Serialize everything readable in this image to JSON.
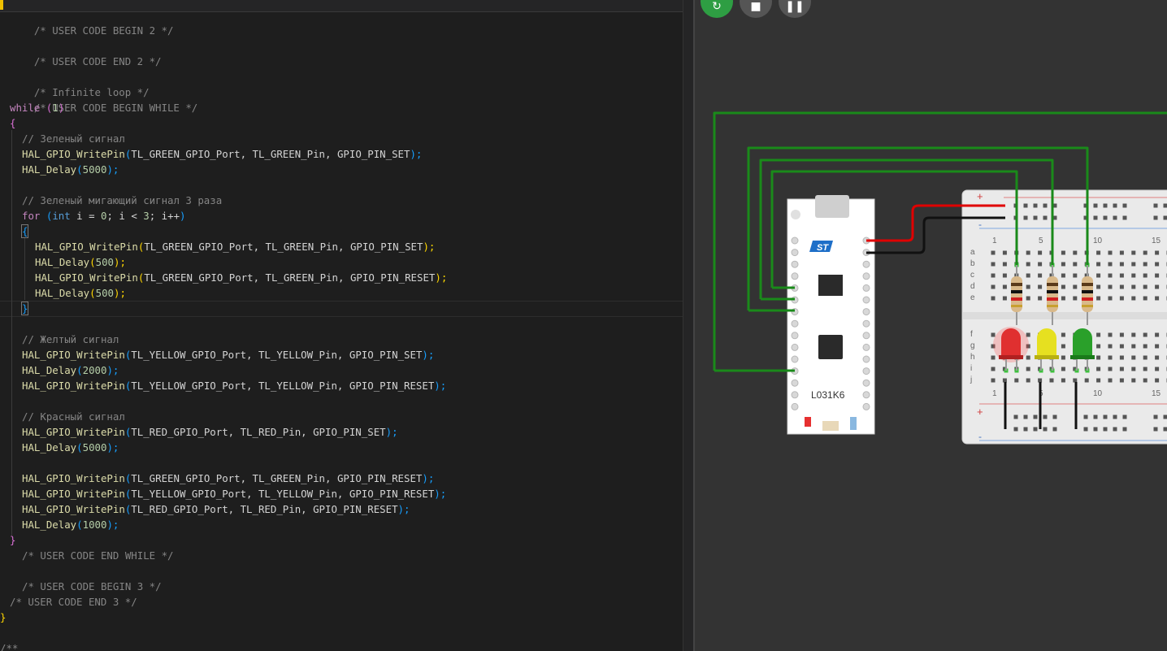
{
  "editor": {
    "comments": {
      "user_begin_2": "/* USER CODE BEGIN 2 */",
      "user_end_2": "/* USER CODE END 2 */",
      "infinite_loop": "/* Infinite loop */",
      "user_begin_while": "/* USER CODE BEGIN WHILE */",
      "green_signal": "// Зеленый сигнал",
      "green_blink": "// Зеленый мигающий сигнал 3 раза",
      "yellow_signal": "// Желтый сигнал",
      "red_signal": "// Красный сигнал",
      "user_end_while": "/* USER CODE END WHILE */",
      "user_begin_3": "/* USER CODE BEGIN 3 */",
      "user_end_3": "/* USER CODE END 3 */",
      "doc_start": "/**"
    },
    "kw": {
      "while": "while",
      "for": "for",
      "int": "int"
    },
    "fn": {
      "write_pin": "HAL_GPIO_WritePin",
      "delay": "HAL_Delay"
    },
    "args": {
      "green": "TL_GREEN_GPIO_Port, TL_GREEN_Pin, ",
      "yellow": "TL_YELLOW_GPIO_Port, TL_YELLOW_Pin, ",
      "red": "TL_RED_GPIO_Port, TL_RED_Pin, ",
      "set": "GPIO_PIN_SET",
      "reset": "GPIO_PIN_RESET"
    },
    "loop": {
      "var": " i = ",
      "cond": "; i < ",
      "inc": "; i++"
    },
    "num": {
      "one": "1",
      "zero": "0",
      "three": "3",
      "d5000": "5000",
      "d500": "500",
      "d2000": "2000",
      "d1000": "1000"
    },
    "punct": {
      "open_paren": "(",
      "close_paren": ")",
      "close_semi": ");",
      "open_brace": "{",
      "close_brace": "}",
      "space": " "
    }
  },
  "simulator": {
    "controls": {
      "restart_icon": "↻",
      "stop_icon": "■",
      "pause_icon": "❚❚"
    },
    "board": {
      "name": "L031K6",
      "logo": "ST"
    },
    "breadboard": {
      "plus": "+",
      "minus": "-",
      "row_labels_top": [
        "a",
        "b",
        "c",
        "d",
        "e"
      ],
      "row_labels_bottom": [
        "f",
        "g",
        "h",
        "i",
        "j"
      ],
      "column_numbers": [
        "1",
        "5",
        "10",
        "15"
      ]
    },
    "leds": [
      {
        "color": "red",
        "hex": "#e03030"
      },
      {
        "color": "yellow",
        "hex": "#e6e020"
      },
      {
        "color": "green",
        "hex": "#2aa02a"
      }
    ],
    "wire_color_signal": "#1a8a1a",
    "wire_color_power": "#e00000",
    "wire_color_ground": "#111111"
  }
}
